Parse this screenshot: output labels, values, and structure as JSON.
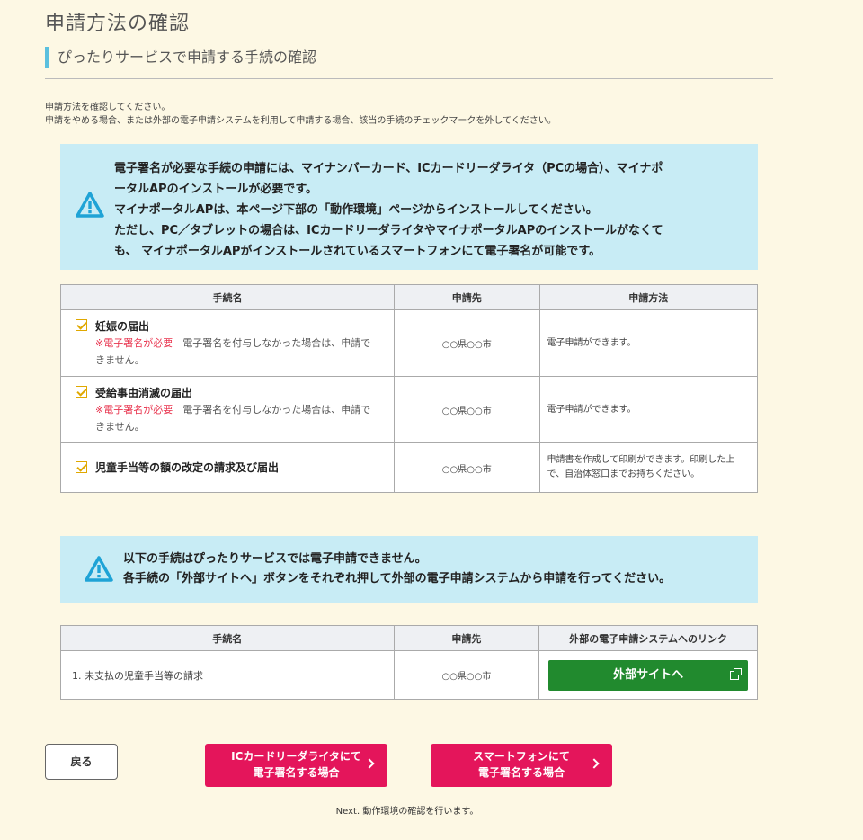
{
  "page": {
    "title": "申請方法の確認",
    "section_title": "ぴったりサービスで申請する手続の確認",
    "intro_lines": [
      "申請方法を確認してください。",
      "申請をやめる場合、または外部の電子申請システムを利用して申請する場合、該当の手続のチェックマークを外してください。"
    ]
  },
  "alert1": {
    "lines": [
      "電子署名が必要な手続の申請には、マイナンバーカード、ICカードリーダライタ（PCの場合）、マイナポ",
      "ータルAPのインストールが必要です。",
      "マイナポータルAPは、本ページ下部の「動作環境」ページからインストールしてください。",
      "ただし、PC／タブレットの場合は、ICカードリーダライタやマイナポータルAPのインストールがなくて",
      "も、 マイナポータルAPがインストールされているスマートフォンにて電子署名が可能です。"
    ]
  },
  "table1": {
    "headers": [
      "手続名",
      "申請先",
      "申請方法"
    ],
    "rows": [
      {
        "name": "妊娠の届出",
        "required": "※電子署名が必要",
        "note": "　電子署名を付与しなかった場合は、申請できません。",
        "dest": "○○県○○市",
        "method": "電子申請ができます。",
        "checked": true
      },
      {
        "name": "受給事由消滅の届出",
        "required": "※電子署名が必要",
        "note": "　電子署名を付与しなかった場合は、申請できません。",
        "dest": "○○県○○市",
        "method": "電子申請ができます。",
        "checked": true
      },
      {
        "name": "児童手当等の額の改定の請求及び届出",
        "required": "",
        "note": "",
        "dest": "○○県○○市",
        "method": "申請書を作成して印刷ができます。印刷した上で、自治体窓口までお持ちください。",
        "checked": true
      }
    ]
  },
  "alert2": {
    "lines": [
      "以下の手続はぴったりサービスでは電子申請できません。",
      "各手続の「外部サイトへ」ボタンをそれぞれ押して外部の電子申請システムから申請を行ってください。"
    ]
  },
  "table2": {
    "headers": [
      "手続名",
      "申請先",
      "外部の電子申請システムへのリンク"
    ],
    "rows": [
      {
        "name": "1. 未支払の児童手当等の請求",
        "dest": "○○県○○市",
        "button": "外部サイトへ"
      }
    ]
  },
  "buttons": {
    "back": "戻る",
    "ic_card": [
      "ICカードリーダライタにて",
      "電子署名する場合"
    ],
    "smartphone": [
      "スマートフォンにて",
      "電子署名する場合"
    ]
  },
  "footer": {
    "next": "Next. 動作環境の確認を行います。"
  },
  "colors": {
    "background": "#fdf8e4",
    "alert": "#c8ecf5",
    "primary_pink": "#e4155b",
    "external_green": "#218a2e",
    "checkbox": "#e0a800"
  }
}
